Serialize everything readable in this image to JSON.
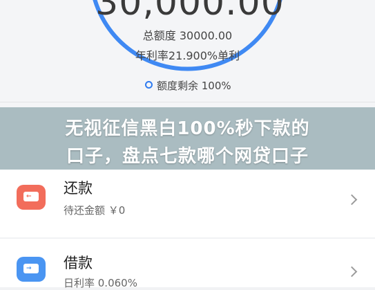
{
  "colors": {
    "accent": "#2f7bf0",
    "repay_icon": "#f26d5b",
    "borrow_icon": "#4a95f2",
    "overlay": "#6e8c96"
  },
  "summary": {
    "amount": "30,000.00",
    "quota": "总额度 30000.00",
    "rate": "年利率21.900%单利",
    "remaining": "额度剩余 100%"
  },
  "headline": {
    "line1": "无视征信黑白100%秒下款的",
    "line2": "口子，盘点七款哪个网贷口子"
  },
  "cards": [
    {
      "title": "还款",
      "subtitle": "待还金额 ￥0",
      "icon": "wallet-icon",
      "icon_text": "←"
    },
    {
      "title": "借款",
      "subtitle": "日利率 0.060%",
      "icon": "card-icon",
      "icon_text": "→"
    }
  ]
}
